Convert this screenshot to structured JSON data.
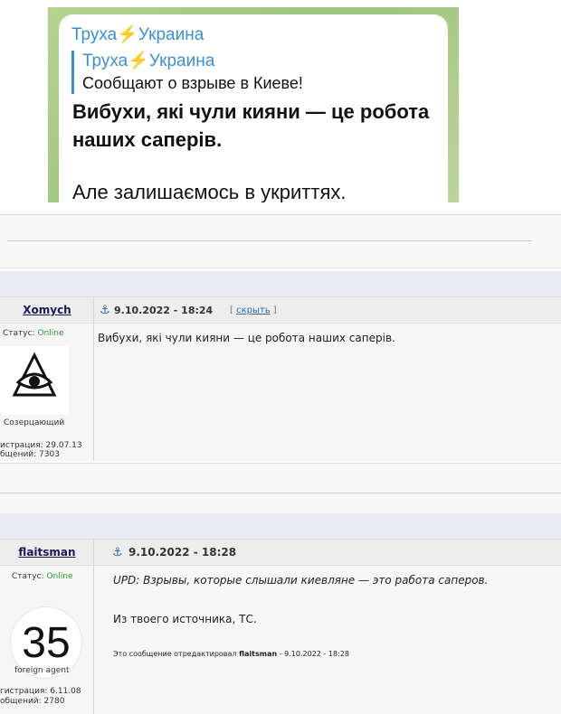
{
  "telegram": {
    "channel_name": "Труха",
    "channel_suffix": "Украина",
    "bolt_icon": "⚡",
    "reply_name": "Труха",
    "reply_suffix": "Украина",
    "reply_text": "Сообщают о взрыве в Киеве!",
    "bold_text": "Вибухи, які чули кияни — це робота наших саперів.",
    "plain_text": "Але залишаємось в укриттях."
  },
  "post1": {
    "author": "Xomych",
    "status_label": "Статус:",
    "status_value": "Online",
    "avatar_icon": "eye-triangle-icon",
    "rank": "Созерцающий",
    "reg": "истрация: 29.07.13",
    "msgs": "бщений: 7303",
    "date": "9.10.2022 - 18:24",
    "hide_open": "[",
    "hide_label": "скрыть",
    "hide_close": "]",
    "text": "Вибухи, які чули кияни — це робота наших саперів."
  },
  "post2": {
    "author": "flaitsman",
    "status_label": "Статус:",
    "status_value": "Online",
    "avatar_number": "35",
    "rank": "foreign agent",
    "reg": "гистрация: 6.11.08",
    "msgs": "общений: 2780",
    "date": "9.10.2022 - 18:28",
    "text_quote": "UPD: Взрывы, которые слышали киевляне — это работа саперов.",
    "text_reply": "Из твоего источника, ТС.",
    "edit_prefix": "Это сообщение отредактировал",
    "edit_author": "flaitsman",
    "edit_suffix": "- 9.10.2022 - 18:28"
  },
  "colors": {
    "telegram_link": "#3a8fd5",
    "online": "#2e9b2e",
    "author": "#1a1a55"
  }
}
